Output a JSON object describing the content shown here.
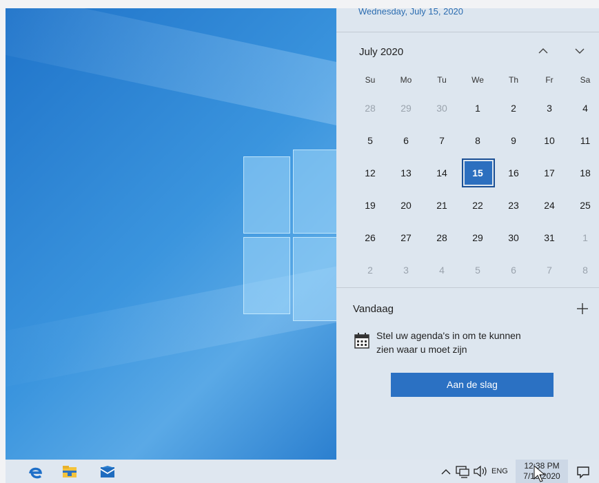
{
  "flyout": {
    "date_line": "Wednesday, July 15, 2020",
    "month_title": "July 2020",
    "weekdays": [
      "Su",
      "Mo",
      "Tu",
      "We",
      "Th",
      "Fr",
      "Sa"
    ],
    "weeks": [
      [
        "28",
        "29",
        "30",
        "1",
        "2",
        "3",
        "4"
      ],
      [
        "5",
        "6",
        "7",
        "8",
        "9",
        "10",
        "11"
      ],
      [
        "12",
        "13",
        "14",
        "15",
        "16",
        "17",
        "18"
      ],
      [
        "19",
        "20",
        "21",
        "22",
        "23",
        "24",
        "25"
      ],
      [
        "26",
        "27",
        "28",
        "29",
        "30",
        "31",
        "1"
      ],
      [
        "2",
        "3",
        "4",
        "5",
        "6",
        "7",
        "8"
      ]
    ],
    "today": "15",
    "agenda_title": "Vandaag",
    "agenda_message_line1": "Stel uw agenda's in om te kunnen",
    "agenda_message_line2": "zien waar u moet zijn",
    "get_started_button": "Aan de slag"
  },
  "taskbar": {
    "pinned": [
      "edge-icon",
      "file-explorer-icon",
      "mail-icon"
    ],
    "language": "ENG",
    "time": "12:38 PM",
    "date": "7/15/2020"
  },
  "colors": {
    "accent": "#2b71c3",
    "today_fill": "#2c6fbf",
    "flyout_bg": "#dde6ef"
  }
}
